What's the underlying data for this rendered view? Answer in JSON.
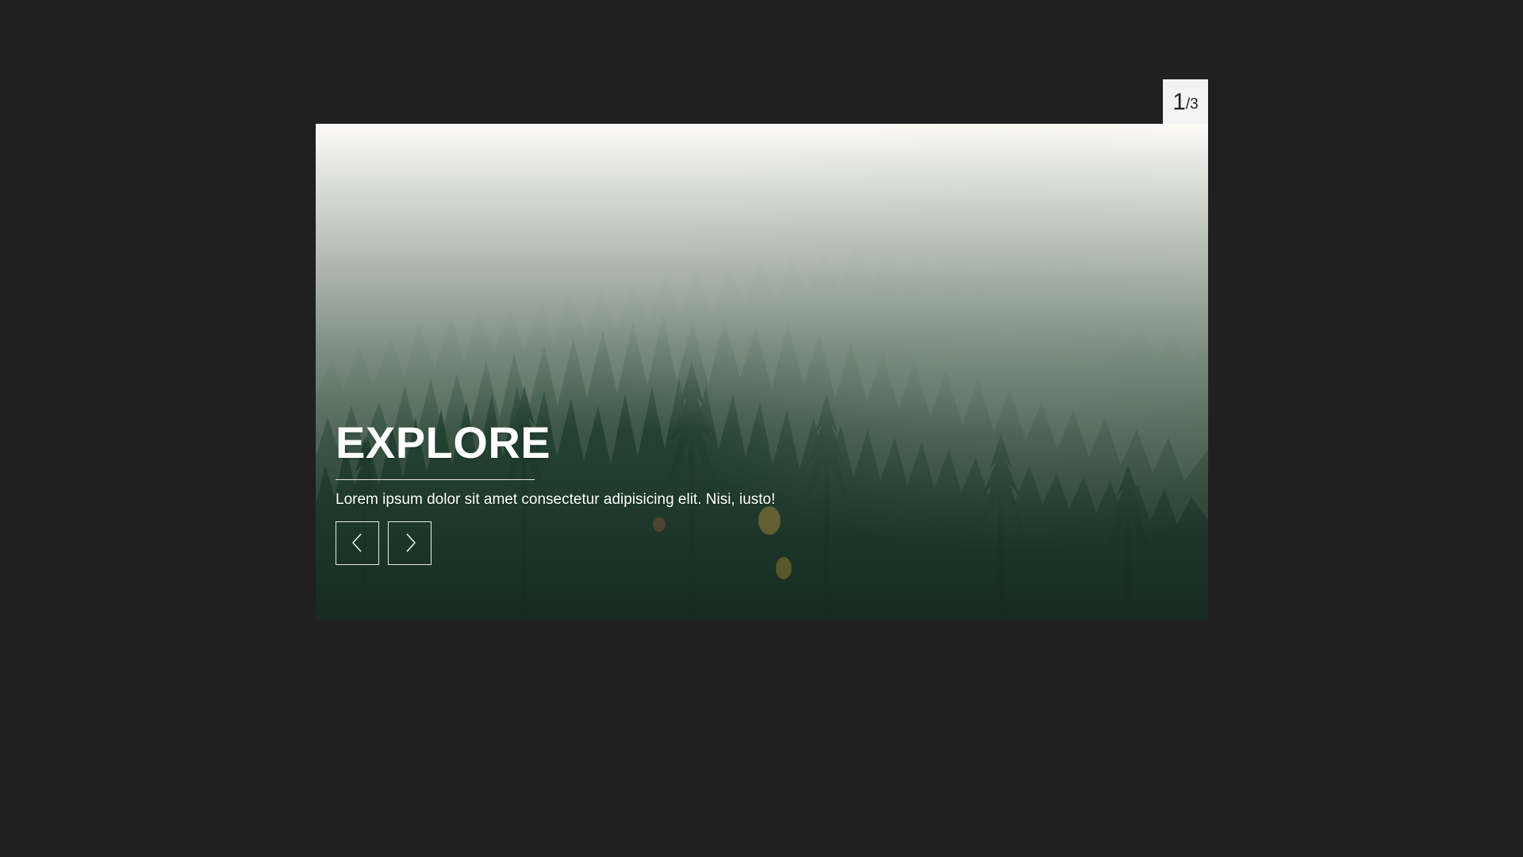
{
  "counter": {
    "current": "1",
    "total": "/3"
  },
  "slide": {
    "title": "EXPLORE",
    "text": "Lorem ipsum dolor sit amet consectetur adipisicing elit. Nisi, iusto!",
    "image": "foggy-pine-forest"
  },
  "navigation": {
    "prev_icon": "chevron-left-icon",
    "next_icon": "chevron-right-icon"
  },
  "colors": {
    "background": "#202020",
    "badge": "#f3f3f3",
    "text": "#ffffff"
  }
}
